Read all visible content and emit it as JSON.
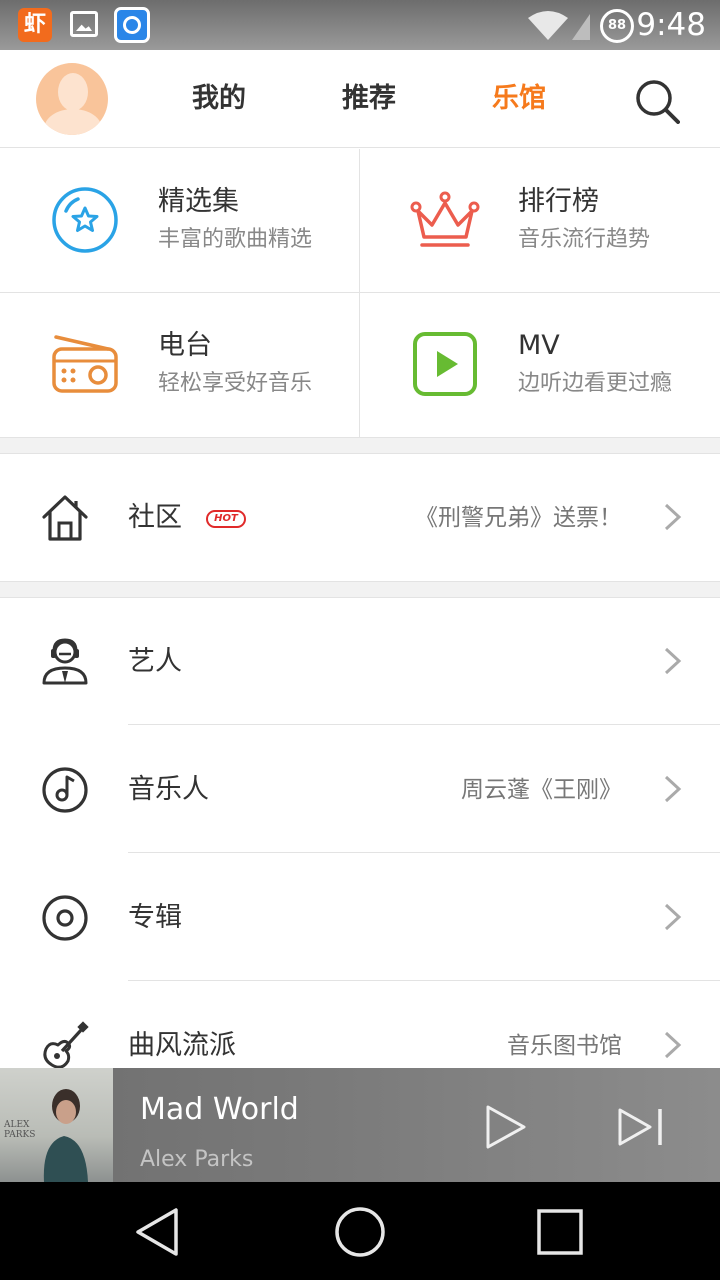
{
  "status_bar": {
    "app_icon_label": "虾",
    "battery_badge": "88",
    "time": "9:48"
  },
  "header": {
    "tabs": [
      {
        "label": "我的",
        "active": false
      },
      {
        "label": "推荐",
        "active": false
      },
      {
        "label": "乐馆",
        "active": true
      }
    ],
    "accent_color": "#f67a1c"
  },
  "grid": [
    {
      "title": "精选集",
      "subtitle": "丰富的歌曲精选",
      "icon": "star-circle-icon",
      "color": "#2aa3e6"
    },
    {
      "title": "排行榜",
      "subtitle": "音乐流行趋势",
      "icon": "crown-icon",
      "color": "#ec5d4e"
    },
    {
      "title": "电台",
      "subtitle": "轻松享受好音乐",
      "icon": "radio-icon",
      "color": "#e88d3c"
    },
    {
      "title": "MV",
      "subtitle": "边听边看更过瘾",
      "icon": "play-square-icon",
      "color": "#67bb32"
    }
  ],
  "community": {
    "label": "社区",
    "badge": "HOT",
    "note": "《刑警兄弟》送票！"
  },
  "list": [
    {
      "label": "艺人",
      "note": "",
      "icon": "artist-icon"
    },
    {
      "label": "音乐人",
      "note": "周云蓬《王刚》",
      "icon": "music-disc-icon"
    },
    {
      "label": "专辑",
      "note": "",
      "icon": "album-icon"
    },
    {
      "label": "曲风流派",
      "note": "音乐图书馆",
      "icon": "guitar-icon"
    }
  ],
  "player": {
    "song": "Mad World",
    "artist": "Alex Parks",
    "cover_text_1": "ALEX",
    "cover_text_2": "PARKS"
  }
}
